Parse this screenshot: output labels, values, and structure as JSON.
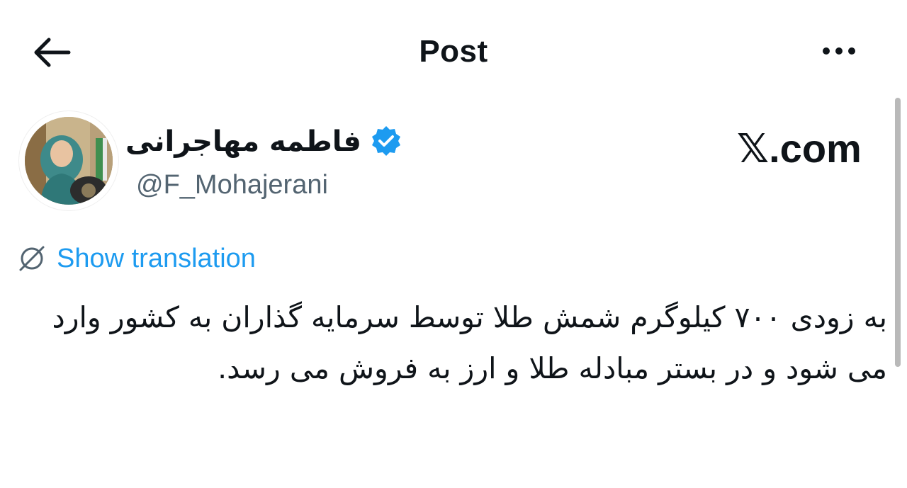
{
  "header": {
    "title": "Post",
    "back_icon": "arrow-left-icon",
    "more_icon": "more-horizontal-icon"
  },
  "author": {
    "display_name": "فاطمه مهاجرانی",
    "handle": "@F_Mohajerani",
    "verified": true,
    "verified_color": "#1d9bf0"
  },
  "watermark": {
    "text": "𝕏.com"
  },
  "translation": {
    "label": "Show translation",
    "icon": "globe-slash-icon",
    "color": "#1d9bf0"
  },
  "post": {
    "text": "به زودی ۷۰۰ کیلوگرم شمش طلا توسط سرمایه گذاران به کشور وارد می شود و در بستر مبادله طلا و ارز به فروش می رسد."
  },
  "colors": {
    "text": "#0f1419",
    "secondary": "#536471",
    "accent": "#1d9bf0"
  }
}
